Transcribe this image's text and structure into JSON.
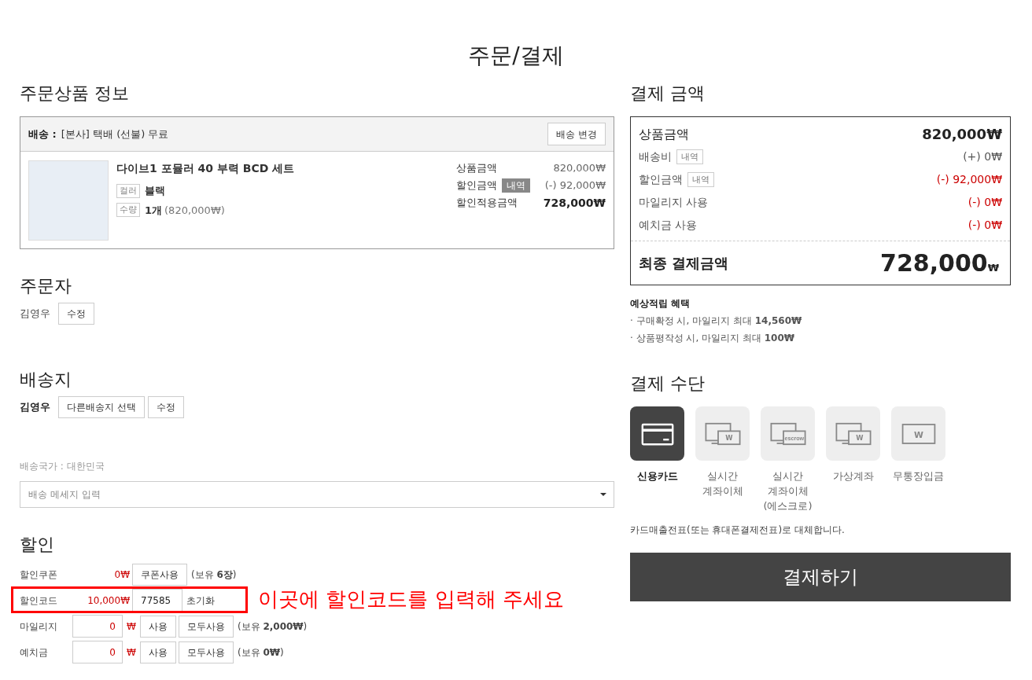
{
  "page_title": "주문/결제",
  "order_items": {
    "heading": "주문상품 정보",
    "shipping": {
      "label": "배송 :",
      "value": "[본사] 택배 (선불) 무료",
      "button": "배송 변경"
    },
    "product": {
      "name": "다이브1 포뮬러 40 부력 BCD 세트",
      "options": [
        {
          "label": "컬러",
          "value": "블랙"
        },
        {
          "label": "수량",
          "value": "1개",
          "detail": "(820,000₩)"
        }
      ],
      "prices": [
        {
          "label": "상품금액",
          "value": "820,000₩",
          "emphasis": false
        },
        {
          "label": "할인금액",
          "badge": "내역",
          "value": "(-) 92,000₩",
          "emphasis": false
        },
        {
          "label": "할인적용금액",
          "value": "728,000₩",
          "emphasis": true
        }
      ]
    }
  },
  "orderer": {
    "heading": "주문자",
    "name": "김영우",
    "buttons": [
      "수정"
    ]
  },
  "shipping_address": {
    "heading": "배송지",
    "name": "김영우",
    "buttons": [
      "다른배송지 선택",
      "수정"
    ],
    "country": "배송국가 : 대한민국",
    "message": {
      "placeholder": "배송 메세지 입력"
    }
  },
  "discount": {
    "heading": "할인",
    "rows": [
      {
        "kind": "coupon",
        "label": "할인쿠폰",
        "amount": "0₩",
        "buttons": [
          "쿠폰사용"
        ],
        "note": "(보유 **6장**)",
        "highlighted": false
      },
      {
        "kind": "code",
        "label": "할인코드",
        "amount": "10,000₩",
        "value": "77585",
        "action": "초기화",
        "highlighted": true
      },
      {
        "kind": "points",
        "label": "마일리지",
        "value": "0",
        "unit": "₩",
        "buttons": [
          "사용",
          "모두사용"
        ],
        "note": "(보유 **2,000₩**)",
        "highlighted": false
      },
      {
        "kind": "points",
        "label": "예치금",
        "value": "0",
        "unit": "₩",
        "buttons": [
          "사용",
          "모두사용"
        ],
        "note": "(보유 **0₩**)",
        "highlighted": false
      }
    ],
    "callout": "이곳에 할인코드를 입력해 주세요"
  },
  "payment_summary": {
    "heading": "결제 금액",
    "rows": [
      {
        "kind": "subtotal",
        "label": "상품금액",
        "value": "820,000₩",
        "deduction": false
      },
      {
        "kind": "line",
        "label": "배송비",
        "badge": "내역",
        "value": "(+) 0₩",
        "deduction": false
      },
      {
        "kind": "line",
        "label": "할인금액",
        "badge": "내역",
        "value": "(-) 92,000₩",
        "deduction": true
      },
      {
        "kind": "line",
        "label": "마일리지 사용",
        "value": "(-) 0₩",
        "deduction": true
      },
      {
        "kind": "line",
        "label": "예치금 사용",
        "value": "(-) 0₩",
        "deduction": true
      }
    ],
    "total": {
      "label": "최종 결제금액",
      "value": "728,000",
      "unit": "₩"
    }
  },
  "benefits": {
    "title": "예상적립 혜택",
    "items": [
      "· 구매확정 시, 마일리지 최대 **14,560₩**",
      "· 상품평작성 시, 마일리지 최대 **100₩**"
    ]
  },
  "payment_methods": {
    "heading": "결제 수단",
    "methods": [
      {
        "kind": "card",
        "lines": [
          "신용카드"
        ],
        "selected": true
      },
      {
        "kind": "transfer",
        "icon_text": "W",
        "lines": [
          "실시간",
          "계좌이체"
        ],
        "selected": false
      },
      {
        "kind": "escrow",
        "icon_text": "escrow",
        "lines": [
          "실시간",
          "계좌이체",
          "(에스크로)"
        ],
        "selected": false
      },
      {
        "kind": "virtual",
        "icon_text": "W",
        "lines": [
          "가상계좌"
        ],
        "selected": false
      },
      {
        "kind": "deposit",
        "icon_text": "W",
        "lines": [
          "무통장입금"
        ],
        "selected": false
      }
    ],
    "note": "카드매출전표(또는 휴대폰결제전표)로 대체합니다.",
    "submit": "결제하기"
  }
}
